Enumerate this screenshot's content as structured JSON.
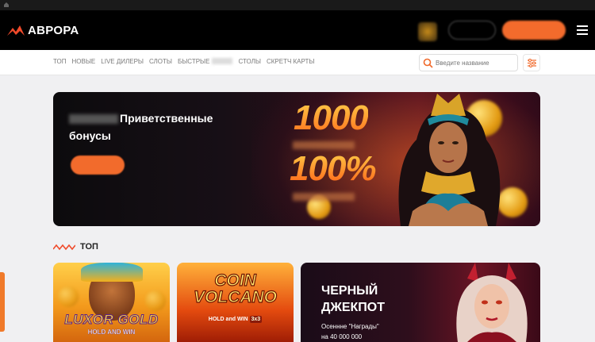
{
  "header": {
    "logo_text": "АВРОРА",
    "accent_color": "#f36b2c"
  },
  "nav": {
    "items": [
      "ТОП",
      "НОВЫЕ",
      "LIVE ДИЛЕРЫ",
      "СЛОТЫ",
      "БЫСТРЫЕ",
      "СТОЛЫ",
      "СКРЕТЧ КАРТЫ"
    ],
    "search_placeholder": "Введите название"
  },
  "banner": {
    "title": "Приветственные бонусы",
    "amount": "1000",
    "percent": "100%"
  },
  "section": {
    "title": "ТОП"
  },
  "games": [
    {
      "title": "LUXOR GOLD",
      "subtitle": "HOLD AND WIN"
    },
    {
      "title_line1": "COIN",
      "title_line2": "VOLCANO",
      "subtitle": "HOLD and WIN",
      "badge": "3x3"
    }
  ],
  "promo": {
    "title_line1": "ЧЕРНЫЙ",
    "title_line2": "ДЖЕКПОТ",
    "text_line1": "Осеннне \"Награды\"",
    "text_line2": "на 40 000 000"
  }
}
